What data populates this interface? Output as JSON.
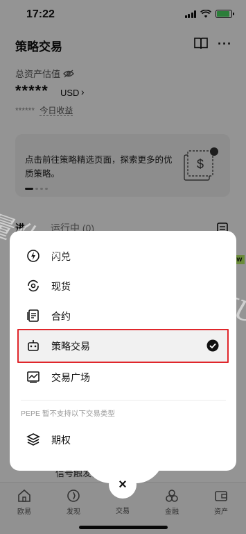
{
  "status_bar": {
    "time": "17:22"
  },
  "header": {
    "title": "策略交易",
    "more_label": "···"
  },
  "asset": {
    "label": "总资产估值",
    "value": "*****",
    "unit": "USD",
    "chevron": "›",
    "today_masked": "******",
    "today_label": "今日收益"
  },
  "banner": {
    "text": "点击前往策略精选页面，探索更多的优质策略。"
  },
  "tabs": {
    "strategy": "进行",
    "running": "运行中 (0)"
  },
  "badge_new": "ew",
  "behind_text": "信号触发，分批…",
  "menu": {
    "items": [
      {
        "label": "闪兑",
        "icon": "flash-swap-icon"
      },
      {
        "label": "现货",
        "icon": "spot-icon"
      },
      {
        "label": "合约",
        "icon": "contract-icon"
      },
      {
        "label": "策略交易",
        "icon": "robot-icon",
        "selected": true
      },
      {
        "label": "交易广场",
        "icon": "trading-square-icon"
      }
    ],
    "unsupported_note": "PEPE 暂不支持以下交易类型",
    "options_label": "期权"
  },
  "close_label": "×",
  "bottom_nav": {
    "items": [
      {
        "label": "欧易",
        "icon": "home-icon"
      },
      {
        "label": "发现",
        "icon": "discover-icon"
      },
      {
        "label": "交易",
        "icon": "trade-icon"
      },
      {
        "label": "金融",
        "icon": "finance-icon"
      },
      {
        "label": "资产",
        "icon": "wallet-icon"
      }
    ]
  },
  "watermark": "量化魔方www.115KU.com",
  "colors": {
    "highlight_border": "#e0262b",
    "new_badge": "#b7f064"
  }
}
